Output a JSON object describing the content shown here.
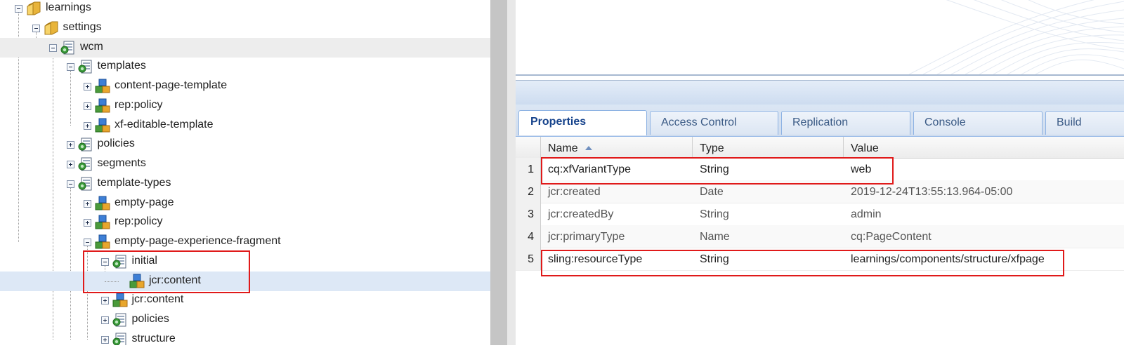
{
  "tree": {
    "nodes": [
      {
        "label": "learnings",
        "icon": "folder-icon"
      },
      {
        "label": "settings",
        "icon": "folder-icon"
      },
      {
        "label": "wcm",
        "icon": "page-node-icon"
      },
      {
        "label": "templates",
        "icon": "page-node-icon"
      },
      {
        "label": "content-page-template",
        "icon": "component-node-icon"
      },
      {
        "label": "rep:policy",
        "icon": "component-node-icon"
      },
      {
        "label": "xf-editable-template",
        "icon": "component-node-icon"
      },
      {
        "label": "policies",
        "icon": "page-node-icon"
      },
      {
        "label": "segments",
        "icon": "page-node-icon"
      },
      {
        "label": "template-types",
        "icon": "page-node-icon"
      },
      {
        "label": "empty-page",
        "icon": "component-node-icon"
      },
      {
        "label": "rep:policy",
        "icon": "component-node-icon"
      },
      {
        "label": "empty-page-experience-fragment",
        "icon": "component-node-icon"
      },
      {
        "label": "initial",
        "icon": "page-node-icon"
      },
      {
        "label": "jcr:content",
        "icon": "component-node-icon"
      },
      {
        "label": "jcr:content",
        "icon": "component-node-icon"
      },
      {
        "label": "policies",
        "icon": "page-node-icon"
      },
      {
        "label": "structure",
        "icon": "page-node-icon"
      }
    ]
  },
  "tabs": [
    "Properties",
    "Access Control",
    "Replication",
    "Console",
    "Build"
  ],
  "grid": {
    "headers": {
      "name": "Name",
      "type": "Type",
      "value": "Value"
    },
    "rows": [
      {
        "num": "1",
        "name": "cq:xfVariantType",
        "type": "String",
        "value": "web"
      },
      {
        "num": "2",
        "name": "jcr:created",
        "type": "Date",
        "value": "2019-12-24T13:55:13.964-05:00"
      },
      {
        "num": "3",
        "name": "jcr:createdBy",
        "type": "String",
        "value": "admin"
      },
      {
        "num": "4",
        "name": "jcr:primaryType",
        "type": "Name",
        "value": "cq:PageContent"
      },
      {
        "num": "5",
        "name": "sling:resourceType",
        "type": "String",
        "value": "learnings/components/structure/xfpage"
      }
    ]
  },
  "colors": {
    "highlight_box": "#e01a1a",
    "selected_row": "#dde8f6",
    "tab_text": "#15428b"
  }
}
